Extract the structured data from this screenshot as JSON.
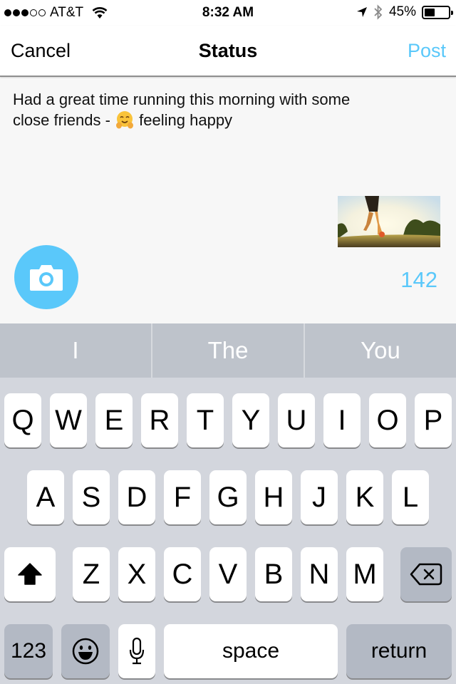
{
  "status_bar": {
    "carrier": "AT&T",
    "signal_bars_filled": 3,
    "signal_bars_total": 5,
    "time": "8:32 AM",
    "battery_percent": "45%",
    "battery_level": 0.45,
    "icons": [
      "wifi-icon",
      "location-arrow-icon",
      "bluetooth-icon",
      "battery-icon"
    ]
  },
  "navbar": {
    "cancel_label": "Cancel",
    "title": "Status",
    "post_label": "Post"
  },
  "compose": {
    "text_before_emoji": "Had a great time running this morning with some close friends - ",
    "emoji": "hugging-face",
    "text_after_emoji": " feeling happy",
    "attached_photo": "runner-on-trail-photo",
    "character_count": "142"
  },
  "suggestions": [
    "I",
    "The",
    "You"
  ],
  "keyboard": {
    "row1": [
      "Q",
      "W",
      "E",
      "R",
      "T",
      "Y",
      "U",
      "I",
      "O",
      "P"
    ],
    "row2": [
      "A",
      "S",
      "D",
      "F",
      "G",
      "H",
      "J",
      "K",
      "L"
    ],
    "row3": [
      "Z",
      "X",
      "C",
      "V",
      "B",
      "N",
      "M"
    ],
    "numbers_label": "123",
    "space_label": "space",
    "return_label": "return"
  },
  "colors": {
    "accent": "#5ac8fa",
    "camera_button": "#5ac8fa",
    "count": "#5ac8fa"
  }
}
